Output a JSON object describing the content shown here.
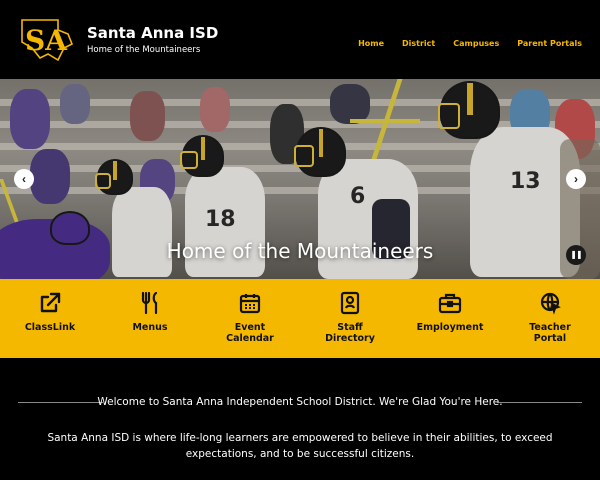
{
  "header": {
    "title": "Santa Anna ISD",
    "tagline": "Home of the Mountaineers",
    "logo_text": "SA",
    "nav": [
      {
        "label": "Home"
      },
      {
        "label": "District"
      },
      {
        "label": "Campuses"
      },
      {
        "label": "Parent Portals"
      }
    ]
  },
  "hero": {
    "caption": "Home of the Mountaineers",
    "jersey_numbers": [
      "18",
      "6",
      "13"
    ],
    "prev_icon": "chevron-left-icon",
    "next_icon": "chevron-right-icon",
    "pause_icon": "pause-icon"
  },
  "quick_links": [
    {
      "label": "ClassLink",
      "icon": "external-link-icon"
    },
    {
      "label": "Menus",
      "icon": "utensils-icon"
    },
    {
      "label": "Event Calendar",
      "icon": "calendar-icon"
    },
    {
      "label": "Staff Directory",
      "icon": "contact-card-icon"
    },
    {
      "label": "Employment",
      "icon": "briefcase-icon"
    },
    {
      "label": "Teacher Portal",
      "icon": "globe-cursor-icon"
    }
  ],
  "welcome": {
    "heading": "Welcome to Santa Anna Independent School District. We're Glad You're Here.",
    "body": "Santa Anna ISD is where life-long learners are empowered to believe in their abilities, to exceed expectations, and to be successful citizens."
  },
  "colors": {
    "accent": "#f5b800",
    "background": "#000000",
    "text": "#ffffff"
  }
}
